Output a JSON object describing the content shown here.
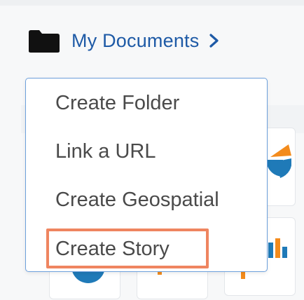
{
  "breadcrumb": {
    "label": "My Documents",
    "folder_icon": "folder-icon",
    "chevron_icon": "chevron-right-icon"
  },
  "menu": {
    "items": [
      {
        "label": "Create Folder"
      },
      {
        "label": "Link a URL"
      },
      {
        "label": "Create Geospatial"
      },
      {
        "label": "Create Story",
        "highlighted": true
      }
    ]
  },
  "colors": {
    "link_blue": "#1e5aa6",
    "menu_border": "#6da0dc",
    "highlight": "#ef8560",
    "menu_text": "#4a4a4a",
    "chart_blue": "#1f7ab8",
    "chart_orange": "#f38b1c"
  }
}
